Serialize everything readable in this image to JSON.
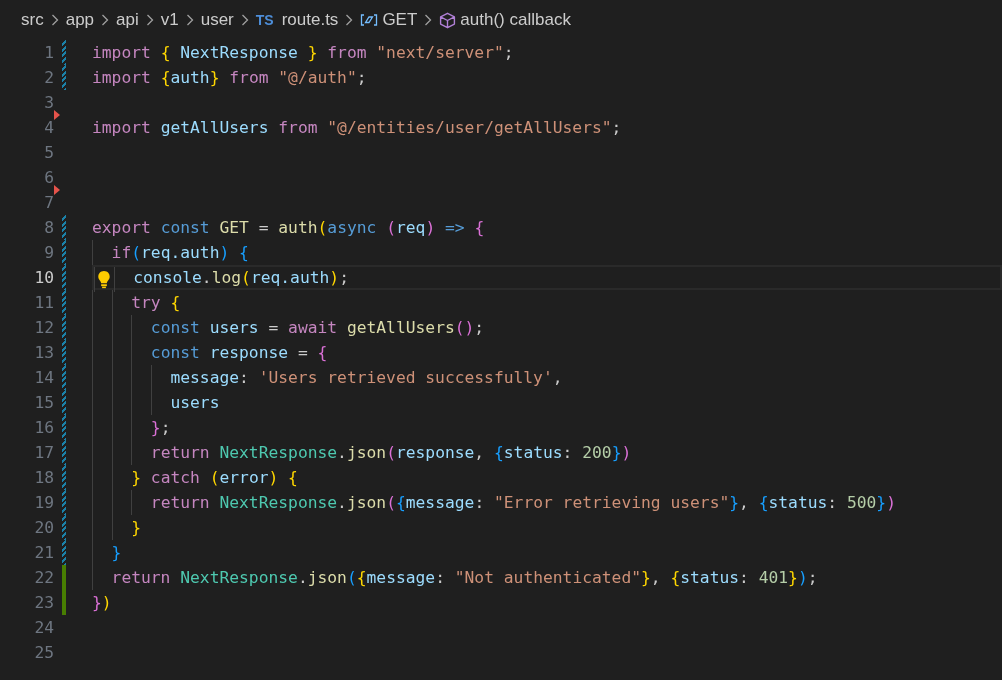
{
  "breadcrumbs": [
    {
      "label": "src",
      "kind": "folder"
    },
    {
      "label": "app",
      "kind": "folder"
    },
    {
      "label": "api",
      "kind": "folder"
    },
    {
      "label": "v1",
      "kind": "folder"
    },
    {
      "label": "user",
      "kind": "folder"
    },
    {
      "label": "route.ts",
      "kind": "file",
      "badge": "TS"
    },
    {
      "label": "GET",
      "kind": "variable"
    },
    {
      "label": "auth() callback",
      "kind": "function"
    }
  ],
  "lines": [
    {
      "number": "1",
      "modified": true,
      "added": false,
      "deleted_above": false,
      "current": false,
      "lightbulb": false,
      "tokens": [
        {
          "text": "import ",
          "kind": "keyword"
        },
        {
          "text": "{",
          "kind": "bracket1"
        },
        {
          "text": " NextResponse ",
          "kind": "variable"
        },
        {
          "text": "}",
          "kind": "bracket1"
        },
        {
          "text": " from ",
          "kind": "keyword"
        },
        {
          "text": "\"next/server\"",
          "kind": "string"
        },
        {
          "text": ";",
          "kind": "plain"
        }
      ]
    },
    {
      "number": "2",
      "modified": true,
      "added": false,
      "deleted_above": false,
      "current": false,
      "lightbulb": false,
      "tokens": [
        {
          "text": "import ",
          "kind": "keyword"
        },
        {
          "text": "{",
          "kind": "bracket1"
        },
        {
          "text": "auth",
          "kind": "variable"
        },
        {
          "text": "}",
          "kind": "bracket1"
        },
        {
          "text": " from ",
          "kind": "keyword"
        },
        {
          "text": "\"@/auth\"",
          "kind": "string"
        },
        {
          "text": ";",
          "kind": "plain"
        }
      ]
    },
    {
      "number": "3",
      "modified": false,
      "added": false,
      "deleted_above": false,
      "current": false,
      "lightbulb": false
    },
    {
      "number": "4",
      "modified": false,
      "added": false,
      "deleted_above": true,
      "current": false,
      "lightbulb": false,
      "tokens": [
        {
          "text": "import",
          "kind": "keyword"
        },
        {
          "text": " getAllUsers",
          "kind": "variable"
        },
        {
          "text": " from ",
          "kind": "keyword"
        },
        {
          "text": "\"@/entities/user/getAllUsers\"",
          "kind": "string"
        },
        {
          "text": ";",
          "kind": "plain"
        }
      ]
    },
    {
      "number": "5",
      "modified": false,
      "added": false,
      "deleted_above": false,
      "current": false,
      "lightbulb": false
    },
    {
      "number": "6",
      "modified": false,
      "added": false,
      "deleted_above": false,
      "current": false,
      "lightbulb": false
    },
    {
      "number": "7",
      "modified": false,
      "added": false,
      "deleted_above": true,
      "current": false,
      "lightbulb": false
    },
    {
      "number": "8",
      "modified": true,
      "added": false,
      "deleted_above": false,
      "current": false,
      "lightbulb": false,
      "tokens": [
        {
          "text": "export",
          "kind": "keyword"
        },
        {
          "text": " const ",
          "kind": "storage"
        },
        {
          "text": "GET",
          "kind": "function"
        },
        {
          "text": " = ",
          "kind": "plain"
        },
        {
          "text": "auth",
          "kind": "function"
        },
        {
          "text": "(",
          "kind": "bracket1"
        },
        {
          "text": "async ",
          "kind": "storage"
        },
        {
          "text": "(",
          "kind": "bracket2"
        },
        {
          "text": "req",
          "kind": "variable"
        },
        {
          "text": ")",
          "kind": "bracket2"
        },
        {
          "text": " => ",
          "kind": "storage"
        },
        {
          "text": "{",
          "kind": "bracket2"
        }
      ]
    },
    {
      "number": "9",
      "modified": true,
      "added": false,
      "deleted_above": false,
      "current": false,
      "lightbulb": false,
      "tokens": [
        {
          "text": "  if",
          "kind": "keyword"
        },
        {
          "text": "(",
          "kind": "bracket3"
        },
        {
          "text": "req.auth",
          "kind": "variable"
        },
        {
          "text": ") ",
          "kind": "bracket3"
        },
        {
          "text": "{",
          "kind": "bracket3"
        }
      ]
    },
    {
      "number": "10",
      "modified": true,
      "added": false,
      "deleted_above": false,
      "current": true,
      "lightbulb": true,
      "tokens": [
        {
          "text": "    console",
          "kind": "variable"
        },
        {
          "text": ".",
          "kind": "plain"
        },
        {
          "text": "log",
          "kind": "function"
        },
        {
          "text": "(",
          "kind": "bracket1"
        },
        {
          "text": "req.auth",
          "kind": "variable"
        },
        {
          "text": ")",
          "kind": "bracket1"
        },
        {
          "text": ";",
          "kind": "plain"
        }
      ]
    },
    {
      "number": "11",
      "modified": true,
      "added": false,
      "deleted_above": false,
      "current": false,
      "lightbulb": false,
      "tokens": [
        {
          "text": "    try ",
          "kind": "keyword"
        },
        {
          "text": "{",
          "kind": "bracket1"
        }
      ]
    },
    {
      "number": "12",
      "modified": true,
      "added": false,
      "deleted_above": false,
      "current": false,
      "lightbulb": false,
      "tokens": [
        {
          "text": "      const",
          "kind": "storage"
        },
        {
          "text": " users",
          "kind": "variable"
        },
        {
          "text": " = ",
          "kind": "plain"
        },
        {
          "text": "await",
          "kind": "keyword"
        },
        {
          "text": " getAllUsers",
          "kind": "function"
        },
        {
          "text": "()",
          "kind": "bracket2"
        },
        {
          "text": ";",
          "kind": "plain"
        }
      ]
    },
    {
      "number": "13",
      "modified": true,
      "added": false,
      "deleted_above": false,
      "current": false,
      "lightbulb": false,
      "tokens": [
        {
          "text": "      const",
          "kind": "storage"
        },
        {
          "text": " response",
          "kind": "variable"
        },
        {
          "text": " = ",
          "kind": "plain"
        },
        {
          "text": "{",
          "kind": "bracket2"
        }
      ]
    },
    {
      "number": "14",
      "modified": true,
      "added": false,
      "deleted_above": false,
      "current": false,
      "lightbulb": false,
      "tokens": [
        {
          "text": "        message",
          "kind": "variable"
        },
        {
          "text": ": ",
          "kind": "plain"
        },
        {
          "text": "'Users retrieved successfully'",
          "kind": "string"
        },
        {
          "text": ",",
          "kind": "plain"
        }
      ]
    },
    {
      "number": "15",
      "modified": true,
      "added": false,
      "deleted_above": false,
      "current": false,
      "lightbulb": false,
      "tokens": [
        {
          "text": "        users",
          "kind": "variable"
        }
      ]
    },
    {
      "number": "16",
      "modified": true,
      "added": false,
      "deleted_above": false,
      "current": false,
      "lightbulb": false,
      "tokens": [
        {
          "text": "      }",
          "kind": "bracket2"
        },
        {
          "text": ";",
          "kind": "plain"
        }
      ]
    },
    {
      "number": "17",
      "modified": true,
      "added": false,
      "deleted_above": false,
      "current": false,
      "lightbulb": false,
      "tokens": [
        {
          "text": "      return",
          "kind": "keyword"
        },
        {
          "text": " NextResponse",
          "kind": "class"
        },
        {
          "text": ".",
          "kind": "plain"
        },
        {
          "text": "json",
          "kind": "function"
        },
        {
          "text": "(",
          "kind": "bracket2"
        },
        {
          "text": "response",
          "kind": "variable"
        },
        {
          "text": ", ",
          "kind": "plain"
        },
        {
          "text": "{",
          "kind": "bracket3"
        },
        {
          "text": "status",
          "kind": "variable"
        },
        {
          "text": ": ",
          "kind": "plain"
        },
        {
          "text": "200",
          "kind": "number"
        },
        {
          "text": "}",
          "kind": "bracket3"
        },
        {
          "text": ")",
          "kind": "bracket2"
        }
      ]
    },
    {
      "number": "18",
      "modified": true,
      "added": false,
      "deleted_above": false,
      "current": false,
      "lightbulb": false,
      "tokens": [
        {
          "text": "    }",
          "kind": "bracket1"
        },
        {
          "text": " catch ",
          "kind": "keyword"
        },
        {
          "text": "(",
          "kind": "bracket1"
        },
        {
          "text": "error",
          "kind": "variable"
        },
        {
          "text": ") ",
          "kind": "bracket1"
        },
        {
          "text": "{",
          "kind": "bracket1"
        }
      ]
    },
    {
      "number": "19",
      "modified": true,
      "added": false,
      "deleted_above": false,
      "current": false,
      "lightbulb": false,
      "tokens": [
        {
          "text": "      return",
          "kind": "keyword"
        },
        {
          "text": " NextResponse",
          "kind": "class"
        },
        {
          "text": ".",
          "kind": "plain"
        },
        {
          "text": "json",
          "kind": "function"
        },
        {
          "text": "(",
          "kind": "bracket2"
        },
        {
          "text": "{",
          "kind": "bracket3"
        },
        {
          "text": "message",
          "kind": "variable"
        },
        {
          "text": ": ",
          "kind": "plain"
        },
        {
          "text": "\"Error retrieving users\"",
          "kind": "string"
        },
        {
          "text": "}",
          "kind": "bracket3"
        },
        {
          "text": ", ",
          "kind": "plain"
        },
        {
          "text": "{",
          "kind": "bracket3"
        },
        {
          "text": "status",
          "kind": "variable"
        },
        {
          "text": ": ",
          "kind": "plain"
        },
        {
          "text": "500",
          "kind": "number"
        },
        {
          "text": "}",
          "kind": "bracket3"
        },
        {
          "text": ")",
          "kind": "bracket2"
        }
      ]
    },
    {
      "number": "20",
      "modified": true,
      "added": false,
      "deleted_above": false,
      "current": false,
      "lightbulb": false,
      "tokens": [
        {
          "text": "    }",
          "kind": "bracket1"
        }
      ]
    },
    {
      "number": "21",
      "modified": true,
      "added": false,
      "deleted_above": false,
      "current": false,
      "lightbulb": false,
      "tokens": [
        {
          "text": "  }",
          "kind": "bracket3"
        }
      ]
    },
    {
      "number": "22",
      "modified": false,
      "added": true,
      "deleted_above": false,
      "current": false,
      "lightbulb": false,
      "tokens": [
        {
          "text": "  return",
          "kind": "keyword"
        },
        {
          "text": " NextResponse",
          "kind": "class"
        },
        {
          "text": ".",
          "kind": "plain"
        },
        {
          "text": "json",
          "kind": "function"
        },
        {
          "text": "(",
          "kind": "bracket3"
        },
        {
          "text": "{",
          "kind": "bracket1"
        },
        {
          "text": "message",
          "kind": "variable"
        },
        {
          "text": ": ",
          "kind": "plain"
        },
        {
          "text": "\"Not authenticated\"",
          "kind": "string"
        },
        {
          "text": "}",
          "kind": "bracket1"
        },
        {
          "text": ", ",
          "kind": "plain"
        },
        {
          "text": "{",
          "kind": "bracket1"
        },
        {
          "text": "status",
          "kind": "variable"
        },
        {
          "text": ": ",
          "kind": "plain"
        },
        {
          "text": "401",
          "kind": "number"
        },
        {
          "text": "}",
          "kind": "bracket1"
        },
        {
          "text": ")",
          "kind": "bracket3"
        },
        {
          "text": ";",
          "kind": "plain"
        }
      ]
    },
    {
      "number": "23",
      "modified": false,
      "added": true,
      "deleted_above": false,
      "current": false,
      "lightbulb": false,
      "tokens": [
        {
          "text": "}",
          "kind": "bracket2"
        },
        {
          "text": ")",
          "kind": "bracket1"
        }
      ]
    },
    {
      "number": "24",
      "modified": false,
      "added": false,
      "deleted_above": false,
      "current": false,
      "lightbulb": false
    },
    {
      "number": "25",
      "modified": false,
      "added": false,
      "deleted_above": false,
      "current": false,
      "lightbulb": false
    }
  ]
}
